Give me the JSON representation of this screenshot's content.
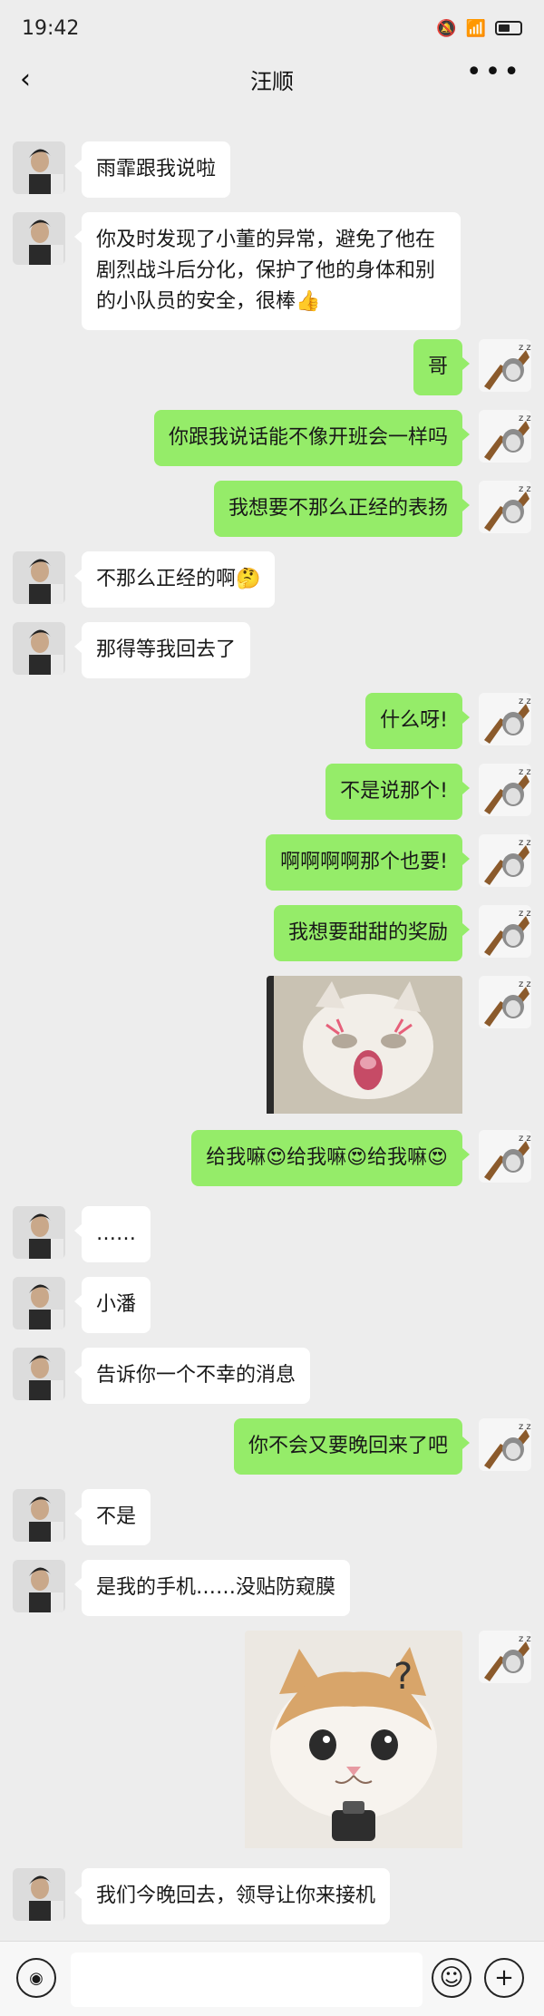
{
  "status": {
    "time": "19:42"
  },
  "header": {
    "title": "汪顺",
    "back": "‹",
    "more": "•••"
  },
  "messages": [
    {
      "side": "left",
      "text": "雨霏跟我说啦"
    },
    {
      "side": "left",
      "text": "你及时发现了小董的异常，避免了他在剧烈战斗后分化，保护了他的身体和别的小队员的安全，很棒👍"
    },
    {
      "side": "right",
      "text": "哥"
    },
    {
      "side": "right",
      "text": "你跟我说话能不像开班会一样吗"
    },
    {
      "side": "right",
      "text": "我想要不那么正经的表扬"
    },
    {
      "side": "left",
      "text": "不那么正经的啊🤔"
    },
    {
      "side": "left",
      "text": "那得等我回去了"
    },
    {
      "side": "right",
      "text": "什么呀!"
    },
    {
      "side": "right",
      "text": "不是说那个!"
    },
    {
      "side": "right",
      "text": "啊啊啊啊那个也要!"
    },
    {
      "side": "right",
      "text": "我想要甜甜的奖励"
    },
    {
      "side": "right",
      "type": "sticker",
      "sticker": "crying-cat-sticker"
    },
    {
      "side": "right",
      "text": "给我嘛😍给我嘛😍给我嘛😍"
    },
    {
      "side": "left",
      "text": "……"
    },
    {
      "side": "left",
      "text": "小潘"
    },
    {
      "side": "left",
      "text": "告诉你一个不幸的消息"
    },
    {
      "side": "right",
      "text": "你不会又要晚回来了吧"
    },
    {
      "side": "left",
      "text": "不是"
    },
    {
      "side": "left",
      "text": "是我的手机……没贴防窥膜"
    },
    {
      "side": "right",
      "type": "sticker",
      "sticker": "confused-cat-sticker"
    },
    {
      "side": "left",
      "text": "我们今晚回去，领导让你来接机"
    }
  ],
  "input": {
    "placeholder": ""
  },
  "colors": {
    "self_bubble": "#95ec69",
    "other_bubble": "#ffffff",
    "background": "#ededed"
  }
}
